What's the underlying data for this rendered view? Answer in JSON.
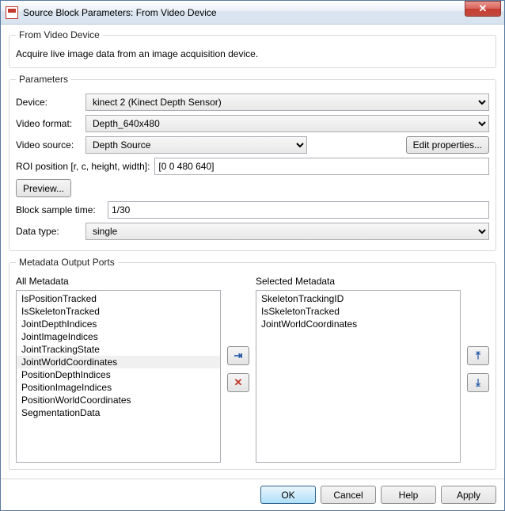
{
  "window": {
    "title": "Source Block Parameters: From Video Device",
    "close_glyph": "✕"
  },
  "header": {
    "group_title": "From Video Device",
    "description": "Acquire live image data from an image acquisition device."
  },
  "parameters": {
    "group_title": "Parameters",
    "device_label": "Device:",
    "device_value": "kinect 2 (Kinect Depth Sensor)",
    "video_format_label": "Video format:",
    "video_format_value": "Depth_640x480",
    "video_source_label": "Video source:",
    "video_source_value": "Depth Source",
    "edit_props_label": "Edit properties...",
    "roi_label": "ROI position [r, c, height, width]:",
    "roi_value": "[0 0 480 640]",
    "preview_label": "Preview...",
    "block_sample_label": "Block sample time:",
    "block_sample_value": "1/30",
    "data_type_label": "Data type:",
    "data_type_value": "single"
  },
  "metadata": {
    "group_title": "Metadata Output Ports",
    "all_label": "All Metadata",
    "selected_label": "Selected Metadata",
    "all_items": [
      "IsPositionTracked",
      "IsSkeletonTracked",
      "JointDepthIndices",
      "JointImageIndices",
      "JointTrackingState",
      "JointWorldCoordinates",
      "PositionDepthIndices",
      "PositionImageIndices",
      "PositionWorldCoordinates",
      "SegmentationData"
    ],
    "selected_items": [
      "SkeletonTrackingID",
      "IsSkeletonTracked",
      "JointWorldCoordinates"
    ],
    "add_glyph": "→",
    "remove_glyph": "✕",
    "up_glyph": "▲",
    "down_glyph": "▼"
  },
  "footer": {
    "ok": "OK",
    "cancel": "Cancel",
    "help": "Help",
    "apply": "Apply"
  }
}
